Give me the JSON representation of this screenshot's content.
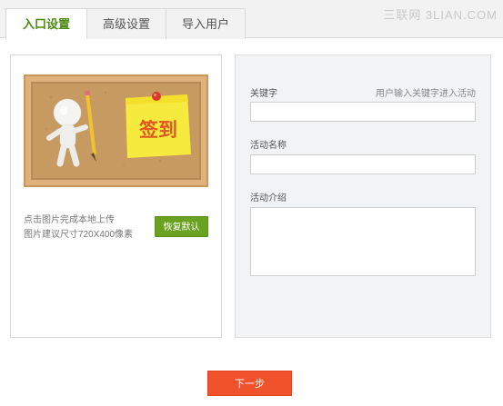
{
  "tabs": [
    {
      "label": "入口设置",
      "active": true
    },
    {
      "label": "高级设置",
      "active": false
    },
    {
      "label": "导入用户",
      "active": false
    }
  ],
  "watermark": "三联网 3LIAN.COM",
  "image_panel": {
    "image_text": "签到",
    "hint_line1": "点击图片完成本地上传",
    "hint_line2": "图片建议尺寸720X400像素",
    "restore_label": "恢复默认"
  },
  "form": {
    "keyword_label": "关键字",
    "keyword_hint": "用户输入关键字进入活动",
    "keyword_value": "",
    "name_label": "活动名称",
    "name_value": "",
    "desc_label": "活动介绍",
    "desc_value": ""
  },
  "next_label": "下一步",
  "colors": {
    "accent_green": "#6aa11f",
    "next_orange": "#f0532b",
    "panel_bg": "#f2f3f5"
  }
}
